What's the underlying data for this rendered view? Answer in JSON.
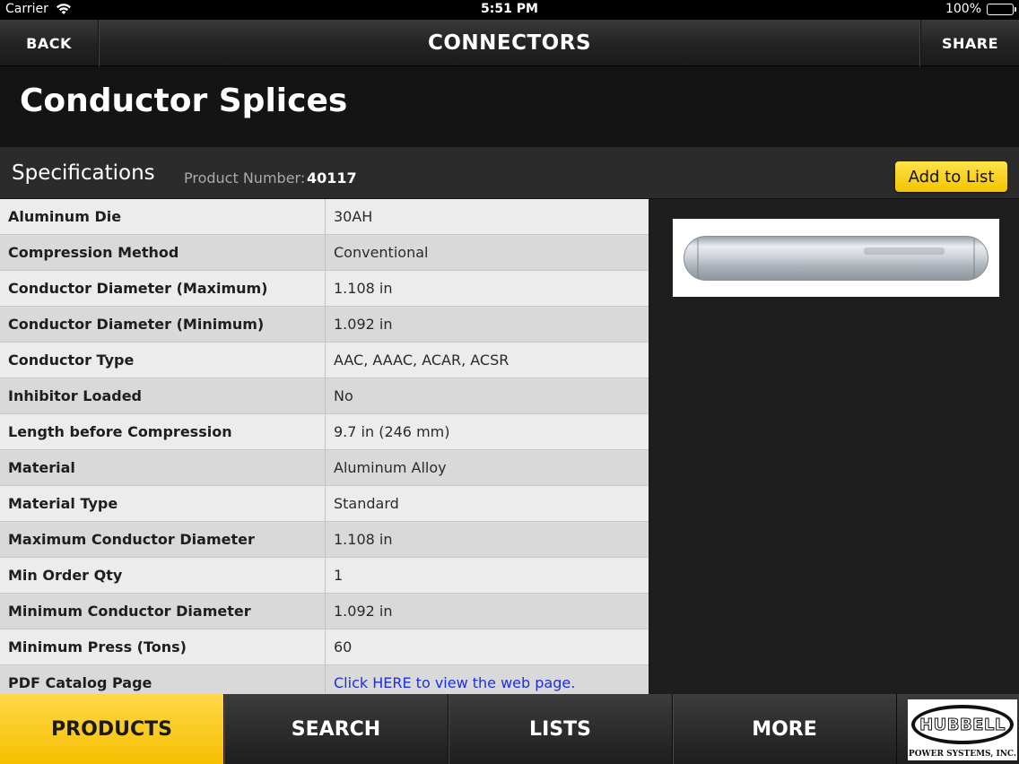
{
  "status_bar": {
    "carrier": "Carrier",
    "time": "5:51 PM",
    "battery": "100%"
  },
  "nav": {
    "back_label": "BACK",
    "title": "CONNECTORS",
    "share_label": "SHARE"
  },
  "page": {
    "title": "Conductor Splices"
  },
  "spec_header": {
    "title": "Specifications",
    "product_number_label": "Product Number:",
    "product_number": "40117",
    "add_to_list_label": "Add to List"
  },
  "specs": [
    {
      "name": "Aluminum Die",
      "value": "30AH"
    },
    {
      "name": "Compression Method",
      "value": "Conventional"
    },
    {
      "name": "Conductor Diameter (Maximum)",
      "value": "1.108 in"
    },
    {
      "name": "Conductor Diameter (Minimum)",
      "value": "1.092 in"
    },
    {
      "name": "Conductor Type",
      "value": "AAC, AAAC, ACAR, ACSR"
    },
    {
      "name": "Inhibitor Loaded",
      "value": "No"
    },
    {
      "name": "Length before Compression",
      "value": "9.7 in (246 mm)"
    },
    {
      "name": "Material",
      "value": "Aluminum Alloy"
    },
    {
      "name": "Material Type",
      "value": "Standard"
    },
    {
      "name": "Maximum Conductor Diameter",
      "value": "1.108 in"
    },
    {
      "name": "Min Order Qty",
      "value": "1"
    },
    {
      "name": "Minimum Conductor Diameter",
      "value": "1.092 in"
    },
    {
      "name": "Minimum Press (Tons)",
      "value": "60"
    },
    {
      "name": "PDF Catalog Page",
      "value": "Click HERE to view the web page."
    }
  ],
  "tabs": [
    {
      "label": "PRODUCTS",
      "active": true
    },
    {
      "label": "SEARCH",
      "active": false
    },
    {
      "label": "LISTS",
      "active": false
    },
    {
      "label": "MORE",
      "active": false
    }
  ],
  "logo": {
    "name": "HUBBELL",
    "subtitle": "POWER SYSTEMS, INC."
  },
  "colors": {
    "accent": "#f5c400",
    "link": "#1a2fe0"
  }
}
